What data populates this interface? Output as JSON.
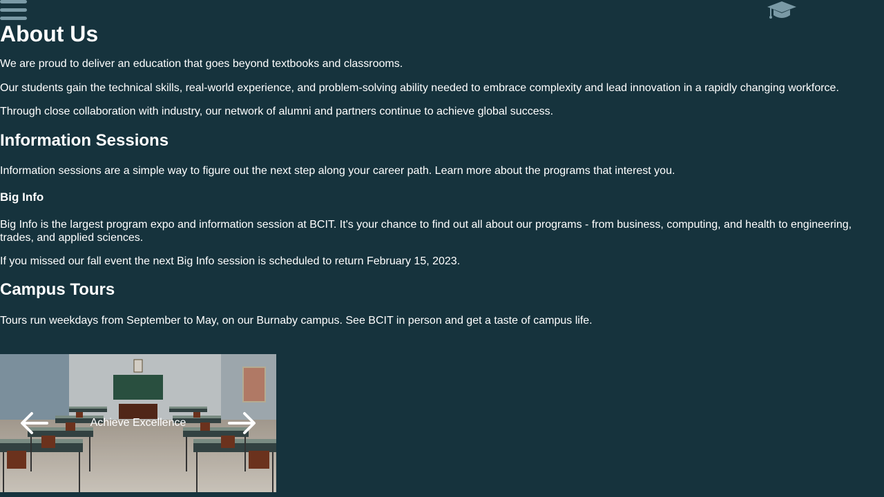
{
  "header": {
    "menu_icon": "hamburger-menu-icon",
    "logo_icon": "graduation-cap-icon"
  },
  "about": {
    "title": "About Us",
    "intro": "We are proud to deliver an education that goes beyond textbooks and classrooms.",
    "skills": "Our students gain the technical skills, real-world experience, and problem-solving ability needed to embrace complexity and lead innovation in a rapidly changing workforce.",
    "collaboration": "Through close collaboration with industry, our network of alumni and partners continue to achieve global success."
  },
  "info_sessions": {
    "title": "Information Sessions",
    "text": "Information sessions are a simple way to figure out the next step along your career path. Learn more about the programs that interest you."
  },
  "big_info": {
    "title": "Big Info",
    "text1": "Big Info is the largest program expo and information session at BCIT. It's your chance to find out all about our programs - from business, computing, and health to engineering, trades, and applied sciences.",
    "text2": "If you missed our fall event the next Big Info session is scheduled to return February 15, 2023."
  },
  "campus_tours": {
    "title": "Campus Tours",
    "text": "Tours run weekdays from September to May, on our Burnaby campus. See BCIT in person and get a taste of campus life."
  },
  "carousel": {
    "caption": "Achieve Excellence",
    "prev_icon": "arrow-left-icon",
    "next_icon": "arrow-right-icon"
  },
  "colors": {
    "background": "#16333d",
    "text": "#ffffff",
    "icon": "#7a9aa6"
  }
}
